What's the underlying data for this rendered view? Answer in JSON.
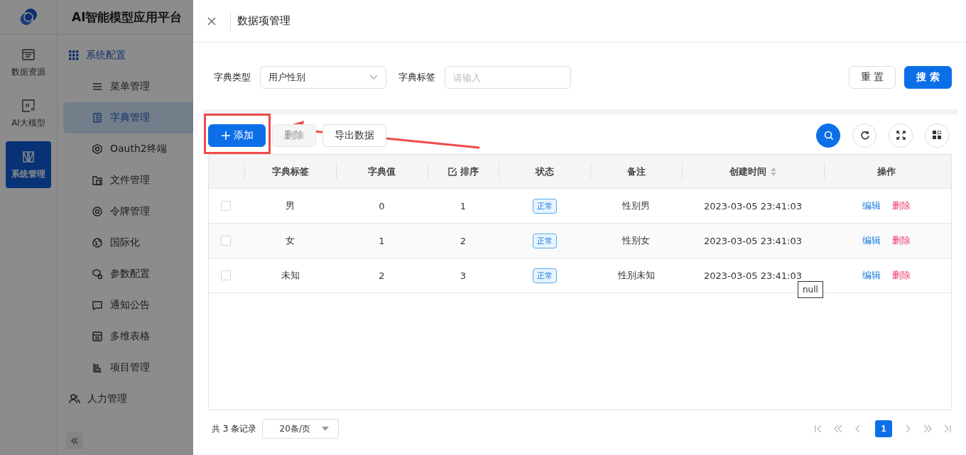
{
  "app": {
    "title": "AI智能模型应用平台"
  },
  "rail": [
    {
      "label": "数据资源",
      "selected": false
    },
    {
      "label": "AI大模型",
      "selected": false
    },
    {
      "label": "系统管理",
      "selected": true
    }
  ],
  "menu": {
    "group": {
      "label": "系统配置"
    },
    "items": [
      {
        "label": "菜单管理",
        "selected": false
      },
      {
        "label": "字典管理",
        "selected": true
      },
      {
        "label": "Oauth2终端",
        "selected": false
      },
      {
        "label": "文件管理",
        "selected": false
      },
      {
        "label": "令牌管理",
        "selected": false
      },
      {
        "label": "国际化",
        "selected": false
      },
      {
        "label": "参数配置",
        "selected": false
      },
      {
        "label": "通知公告",
        "selected": false
      },
      {
        "label": "多维表格",
        "selected": false
      },
      {
        "label": "项目管理",
        "selected": false
      }
    ],
    "others": [
      {
        "label": "人力管理"
      }
    ]
  },
  "drawer": {
    "title": "数据项管理",
    "filters": [
      {
        "kind": "select",
        "label": "字典类型",
        "value": "用户性别"
      },
      {
        "kind": "input",
        "label": "字典标签",
        "placeholder": "请输入"
      }
    ],
    "reset": "重 置",
    "search": "搜 索",
    "toolbar": [
      {
        "label": "添加",
        "kind": "primary",
        "disabled": false
      },
      {
        "label": "删除",
        "kind": "plain",
        "disabled": true
      },
      {
        "label": "导出数据",
        "kind": "plain",
        "disabled": false
      }
    ],
    "columns": [
      {
        "label": "字典标签",
        "editable": false,
        "sortable": false
      },
      {
        "label": "字典值",
        "editable": false,
        "sortable": false
      },
      {
        "label": "排序",
        "editable": true,
        "sortable": false
      },
      {
        "label": "状态",
        "editable": false,
        "sortable": false
      },
      {
        "label": "备注",
        "editable": false,
        "sortable": false
      },
      {
        "label": "创建时间",
        "editable": false,
        "sortable": true
      },
      {
        "label": "操作",
        "editable": false,
        "sortable": false
      }
    ],
    "rows": [
      {
        "checked": false,
        "cells": [
          "男",
          "0",
          "1"
        ],
        "status": "正常",
        "remark": "性别男",
        "created": "2023-03-05 23:41:03",
        "actions": [
          "编辑",
          "删除"
        ]
      },
      {
        "checked": false,
        "cells": [
          "女",
          "1",
          "2"
        ],
        "status": "正常",
        "remark": "性别女",
        "created": "2023-03-05 23:41:03",
        "actions": [
          "编辑",
          "删除"
        ]
      },
      {
        "checked": false,
        "cells": [
          "未知",
          "2",
          "3"
        ],
        "status": "正常",
        "remark": "性别未知",
        "created": "2023-03-05 23:41:03",
        "actions": [
          "编辑",
          "删除"
        ]
      }
    ],
    "tooltip": "null",
    "pager": {
      "total": "共 3 条记录",
      "page_size": "20条/页",
      "pages": [
        {
          "label": "1",
          "selected": true
        }
      ]
    }
  }
}
